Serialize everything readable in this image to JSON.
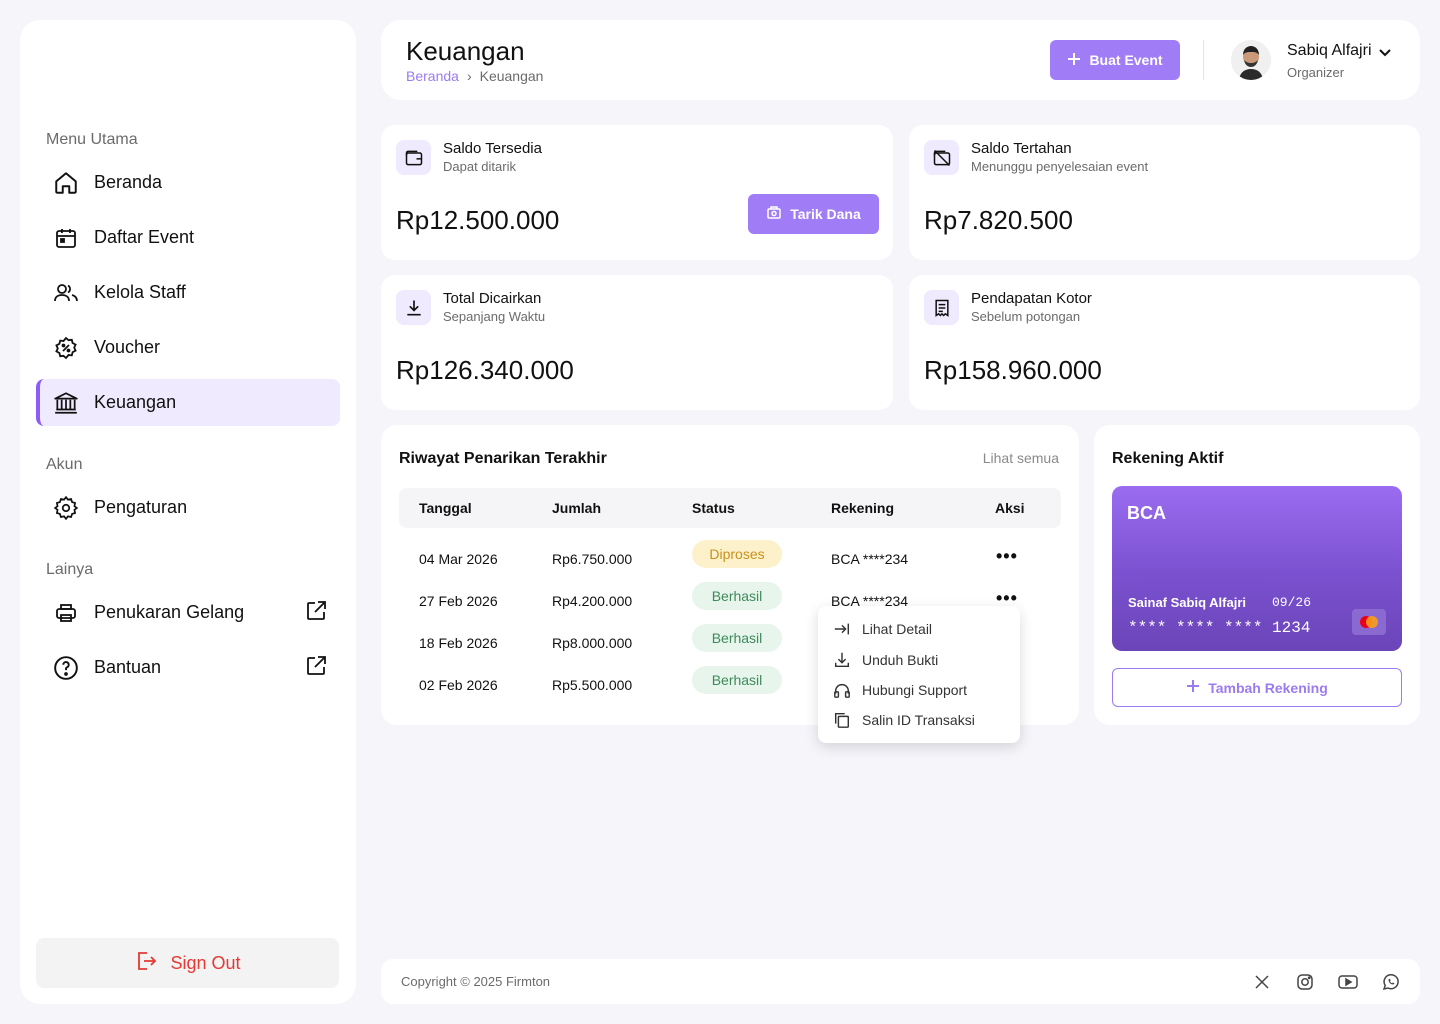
{
  "sidebar": {
    "section_main": "Menu Utama",
    "section_account": "Akun",
    "section_other": "Lainya",
    "items": [
      {
        "label": "Beranda",
        "icon": "home-icon"
      },
      {
        "label": "Daftar Event",
        "icon": "calendar-icon"
      },
      {
        "label": "Kelola Staff",
        "icon": "users-icon"
      },
      {
        "label": "Voucher",
        "icon": "voucher-icon"
      },
      {
        "label": "Keuangan",
        "icon": "bank-icon",
        "active": true
      }
    ],
    "account_items": [
      {
        "label": "Pengaturan",
        "icon": "gear-icon"
      }
    ],
    "other_items": [
      {
        "label": "Penukaran Gelang",
        "icon": "printer-icon"
      },
      {
        "label": "Bantuan",
        "icon": "help-icon"
      }
    ],
    "sign_out": "Sign Out"
  },
  "header": {
    "title": "Keuangan",
    "breadcrumb": [
      "Beranda",
      "Keuangan"
    ],
    "create_button": "Buat Event",
    "user_name": "Sabiq Alfajri",
    "user_role": "Organizer"
  },
  "stats": [
    {
      "title": "Saldo Tersedia",
      "subtitle": "Dapat ditarik",
      "value": "Rp12.500.000",
      "icon": "wallet-icon"
    },
    {
      "title": "Saldo Tertahan",
      "subtitle": "Menunggu penyelesaian event",
      "value": "Rp7.820.500",
      "icon": "wallet-off-icon"
    },
    {
      "title": "Total Dicairkan",
      "subtitle": "Sepanjang Waktu",
      "value": "Rp126.340.000",
      "icon": "download-icon"
    },
    {
      "title": "Pendapatan Kotor",
      "subtitle": "Sebelum potongan",
      "value": "Rp158.960.000",
      "icon": "receipt-icon"
    }
  ],
  "withdraw_button": "Tarik Dana",
  "history": {
    "title": "Riwayat Penarikan Terakhir",
    "see_all": "Lihat semua",
    "columns": [
      "Tanggal",
      "Jumlah",
      "Status",
      "Rekening",
      "Aksi"
    ],
    "rows": [
      {
        "date": "04 Mar 2026",
        "amount": "Rp6.750.000",
        "status": "Diproses",
        "account": "BCA ****234"
      },
      {
        "date": "27 Feb 2026",
        "amount": "Rp4.200.000",
        "status": "Berhasil",
        "account": "BCA ****234"
      },
      {
        "date": "18 Feb 2026",
        "amount": "Rp8.000.000",
        "status": "Berhasil",
        "account": ""
      },
      {
        "date": "02 Feb 2026",
        "amount": "Rp5.500.000",
        "status": "Berhasil",
        "account": ""
      }
    ],
    "action_symbol": "•••"
  },
  "action_menu": {
    "items": [
      {
        "label": "Lihat Detail",
        "icon": "arrow-right-to-line-icon"
      },
      {
        "label": "Unduh Bukti",
        "icon": "download-icon"
      },
      {
        "label": "Hubungi Support",
        "icon": "headphones-icon"
      },
      {
        "label": "Salin ID Transaksi",
        "icon": "copy-icon"
      }
    ]
  },
  "account_panel": {
    "title": "Rekening Aktif",
    "bank": "BCA",
    "holder": "Sainaf Sabiq Alfajri",
    "expiry": "09/26",
    "number": "**** **** **** 1234",
    "add_button": "Tambah Rekening"
  },
  "footer": {
    "copyright": "Copyright © 2025 Firmton",
    "social": [
      "x-icon",
      "instagram-icon",
      "youtube-icon",
      "whatsapp-icon"
    ]
  },
  "colors": {
    "accent": "#a07cf6",
    "danger": "#e53935",
    "active_bg": "#efeafd"
  }
}
